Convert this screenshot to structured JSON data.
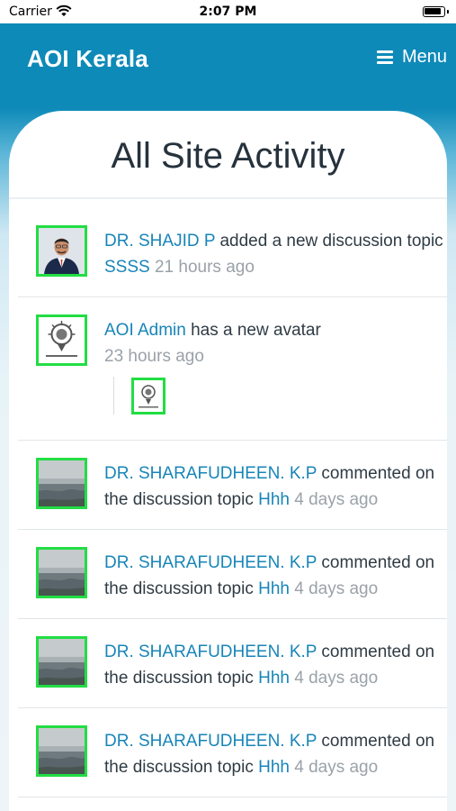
{
  "status_bar": {
    "carrier": "Carrier",
    "time": "2:07 PM"
  },
  "header": {
    "site_title": "AOI Kerala",
    "menu_label": "Menu"
  },
  "page": {
    "title": "All Site Activity"
  },
  "colors": {
    "header_bg": "#0e8ab8",
    "link": "#1785b8",
    "avatar_border": "#22dd44",
    "timestamp": "#9aa2a8"
  },
  "activities": [
    {
      "user": "DR. SHAJID P",
      "action": " added a new discussion topic ",
      "target": "SSSS",
      "time": "21 hours ago",
      "avatar": "person-portrait"
    },
    {
      "user": "AOI Admin",
      "action": " has a new avatar",
      "target": "",
      "time": "23 hours ago",
      "avatar": "aoi-logo"
    },
    {
      "user": "DR. SHARAFUDHEEN. K.P",
      "action": " commented on the discussion topic ",
      "target": "Hhh",
      "time": "4 days ago",
      "avatar": "seascape-photo"
    },
    {
      "user": "DR. SHARAFUDHEEN. K.P",
      "action": " commented on the discussion topic ",
      "target": "Hhh",
      "time": "4 days ago",
      "avatar": "seascape-photo"
    },
    {
      "user": "DR. SHARAFUDHEEN. K.P",
      "action": " commented on the discussion topic ",
      "target": "Hhh",
      "time": "4 days ago",
      "avatar": "seascape-photo"
    },
    {
      "user": "DR. SHARAFUDHEEN. K.P",
      "action": " commented on the discussion topic ",
      "target": "Hhh",
      "time": "4 days ago",
      "avatar": "seascape-photo"
    }
  ]
}
